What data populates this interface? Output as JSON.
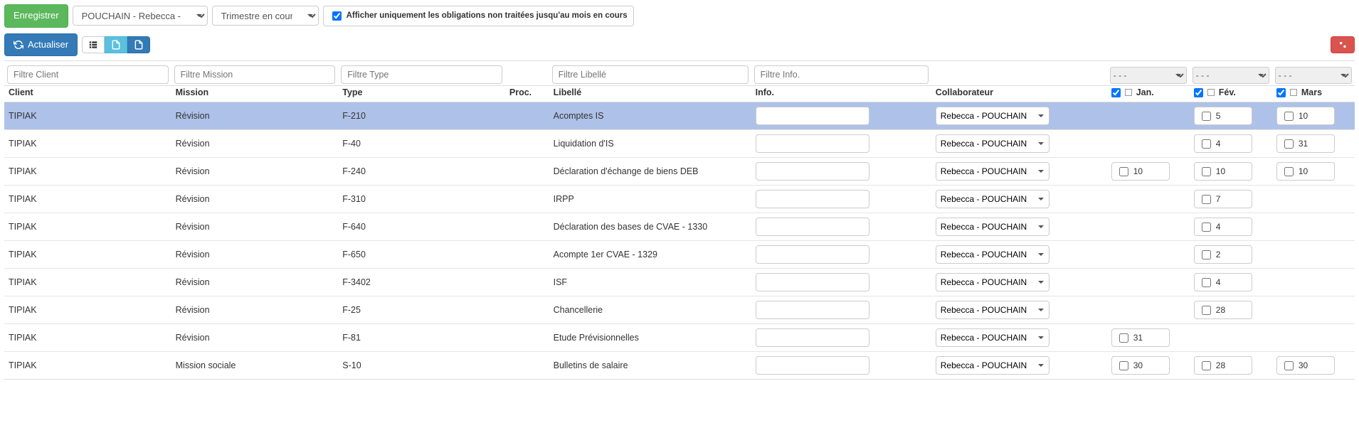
{
  "toolbar": {
    "save_label": "Enregistrer",
    "user_select": "POUCHAIN - Rebecca - RP",
    "period_select": "Trimestre en cours",
    "only_untreated_label": "Afficher uniquement les obligations non traitées jusqu'au mois en cours",
    "only_untreated_checked": true,
    "refresh_label": "Actualiser"
  },
  "filters": {
    "client": "Filtre Client",
    "mission": "Filtre Mission",
    "type": "Filtre Type",
    "libelle": "Filtre Libellé",
    "info": "Filtre Info.",
    "empty_select": "- - -"
  },
  "headers": {
    "client": "Client",
    "mission": "Mission",
    "type": "Type",
    "proc": "Proc.",
    "libelle": "Libellé",
    "info": "Info.",
    "collab": "Collaborateur",
    "months": [
      "Jan.",
      "Fév.",
      "Mars"
    ]
  },
  "default_collab": "Rebecca - POUCHAIN",
  "rows": [
    {
      "client": "TIPIAK",
      "mission": "Révision",
      "type": "F-210",
      "libelle": "Acomptes IS",
      "info": "",
      "collab": "Rebecca - POUCHAIN",
      "m": {
        "jan": "",
        "fev": "5",
        "mars": "10"
      },
      "selected": true
    },
    {
      "client": "TIPIAK",
      "mission": "Révision",
      "type": "F-40",
      "libelle": "Liquidation d'IS",
      "info": "",
      "collab": "Rebecca - POUCHAIN",
      "m": {
        "jan": "",
        "fev": "4",
        "mars": "31"
      }
    },
    {
      "client": "TIPIAK",
      "mission": "Révision",
      "type": "F-240",
      "libelle": "Déclaration d'échange de biens DEB",
      "info": "",
      "collab": "Rebecca - POUCHAIN",
      "m": {
        "jan": "10",
        "fev": "10",
        "mars": "10"
      }
    },
    {
      "client": "TIPIAK",
      "mission": "Révision",
      "type": "F-310",
      "libelle": "IRPP",
      "info": "",
      "collab": "Rebecca - POUCHAIN",
      "m": {
        "jan": "",
        "fev": "7",
        "mars": ""
      }
    },
    {
      "client": "TIPIAK",
      "mission": "Révision",
      "type": "F-640",
      "libelle": "Déclaration des bases de CVAE - 1330",
      "info": "",
      "collab": "Rebecca - POUCHAIN",
      "m": {
        "jan": "",
        "fev": "4",
        "mars": ""
      }
    },
    {
      "client": "TIPIAK",
      "mission": "Révision",
      "type": "F-650",
      "libelle": "Acompte 1er CVAE - 1329",
      "info": "",
      "collab": "Rebecca - POUCHAIN",
      "m": {
        "jan": "",
        "fev": "2",
        "mars": ""
      }
    },
    {
      "client": "TIPIAK",
      "mission": "Révision",
      "type": "F-3402",
      "libelle": "ISF",
      "info": "",
      "collab": "Rebecca - POUCHAIN",
      "m": {
        "jan": "",
        "fev": "4",
        "mars": ""
      }
    },
    {
      "client": "TIPIAK",
      "mission": "Révision",
      "type": "F-25",
      "libelle": "Chancellerie",
      "info": "",
      "collab": "Rebecca - POUCHAIN",
      "m": {
        "jan": "",
        "fev": "28",
        "mars": ""
      }
    },
    {
      "client": "TIPIAK",
      "mission": "Révision",
      "type": "F-81",
      "libelle": "Etude Prévisionnelles",
      "info": "",
      "collab": "Rebecca - POUCHAIN",
      "m": {
        "jan": "31",
        "fev": "",
        "mars": ""
      }
    },
    {
      "client": "TIPIAK",
      "mission": "Mission sociale",
      "type": "S-10",
      "libelle": "Bulletins de salaire",
      "info": "",
      "collab": "Rebecca - POUCHAIN",
      "m": {
        "jan": "30",
        "fev": "28",
        "mars": "30"
      }
    }
  ]
}
